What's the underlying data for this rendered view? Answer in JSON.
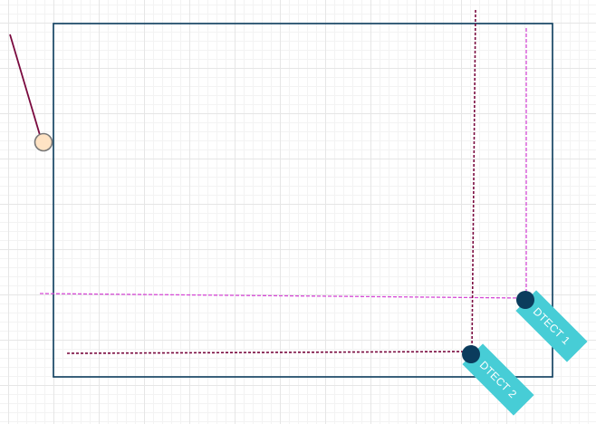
{
  "colors": {
    "frame": "#0b3c5d",
    "tag": "#47cdd6",
    "node": "#0b3c5d",
    "guide_dark": "#7a0a3f",
    "guide_light": "#d64ad6",
    "handle_fill": "#ffe3c4",
    "handle_stroke": "#777777"
  },
  "detectors": [
    {
      "label": "DTECT 1"
    },
    {
      "label": "DTECT 2"
    }
  ]
}
